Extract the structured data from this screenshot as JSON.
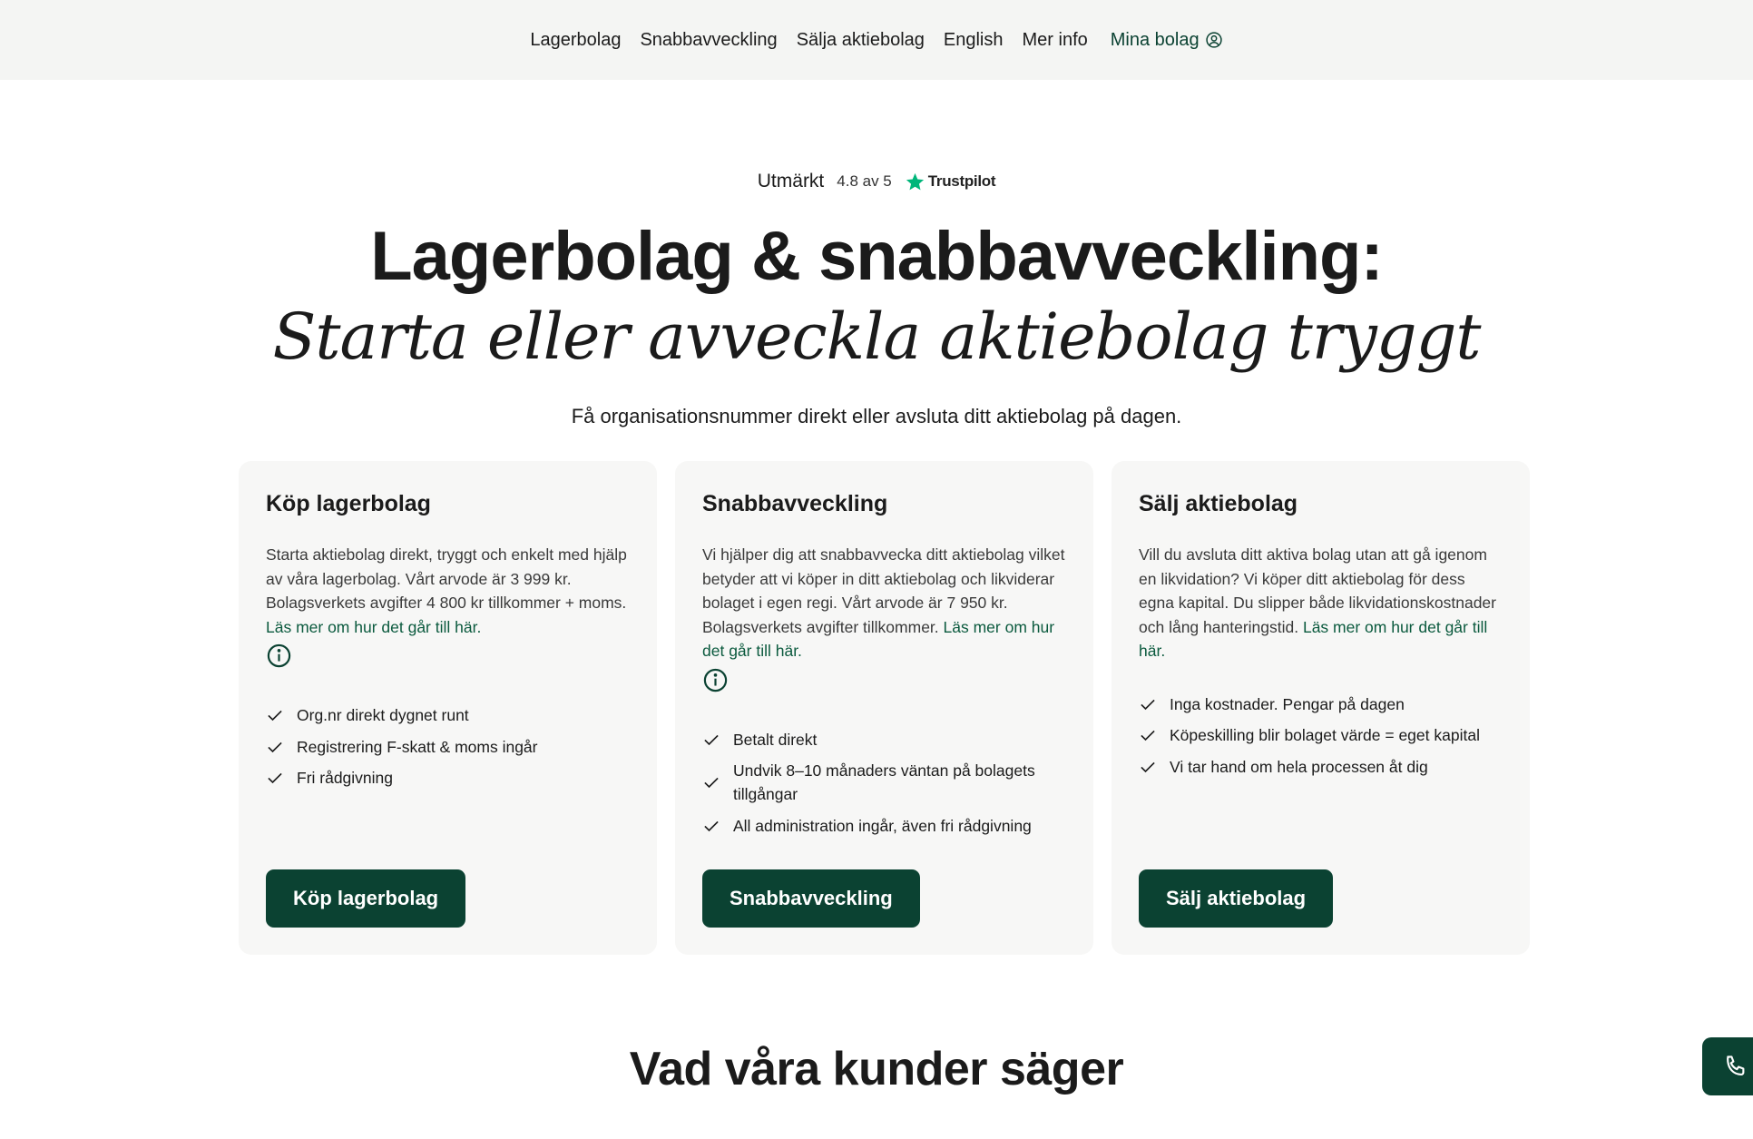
{
  "nav": {
    "items": [
      {
        "label": "Lagerbolag"
      },
      {
        "label": "Snabbavveckling"
      },
      {
        "label": "Sälja aktiebolag"
      },
      {
        "label": "English"
      },
      {
        "label": "Mer info"
      }
    ],
    "account_label": "Mina bolag",
    "account_icon": "user-circle-icon"
  },
  "rating": {
    "word": "Utmärkt",
    "score": "4.8 av 5",
    "brand": "Trustpilot",
    "star_color": "#00b67a"
  },
  "hero": {
    "title": "Lagerbolag & snabbavveckling:",
    "subtitle": "Starta eller avveckla aktiebolag tryggt",
    "lead": "Få organisationsnummer direkt eller avsluta ditt aktiebolag på dagen."
  },
  "cards": [
    {
      "title": "Köp lagerbolag",
      "text": "Starta aktiebolag direkt, tryggt och enkelt med hjälp av våra lagerbolag. Vårt arvode är 3 999 kr. Bolagsverkets avgifter 4 800 kr tillkommer + moms.",
      "link": "Läs mer om hur det går till här.",
      "has_info_icon": true,
      "features": [
        "Org.nr direkt dygnet runt",
        "Registrering F-skatt & moms ingår",
        "Fri rådgivning"
      ],
      "cta": "Köp lagerbolag"
    },
    {
      "title": "Snabbavveckling",
      "text": "Vi hjälper dig att snabbavvecka ditt aktiebolag vilket betyder att vi köper in ditt aktiebolag och likviderar bolaget i egen regi. Vårt arvode är 7 950 kr. Bolagsverkets avgifter tillkommer.",
      "link": "Läs mer om hur det går till här.",
      "has_info_icon": true,
      "features": [
        "Betalt direkt",
        "Undvik 8–10 månaders väntan på bolagets tillgångar",
        "All administration ingår, även fri rådgivning"
      ],
      "cta": "Snabbavveckling"
    },
    {
      "title": "Sälj aktiebolag",
      "text": "Vill du avsluta ditt aktiva bolag utan att gå igenom en likvidation? Vi köper ditt aktiebolag för dess egna kapital. Du slipper både likvidationskostnader och lång hanteringstid.",
      "link": "Läs mer om hur det går till här.",
      "has_info_icon": false,
      "features": [
        "Inga kostnader. Pengar på dagen",
        "Köpeskilling blir bolaget värde = eget kapital",
        "Vi tar hand om hela processen åt dig"
      ],
      "cta": "Sälj aktiebolag"
    }
  ],
  "reviews": {
    "title": "Vad våra kunder säger"
  },
  "floating": {
    "phone_icon": "phone-icon"
  },
  "colors": {
    "brand": "#0b4232",
    "link": "#0b5a3e",
    "topbar_bg": "#f4f5f3",
    "card_bg": "#f7f7f6"
  }
}
